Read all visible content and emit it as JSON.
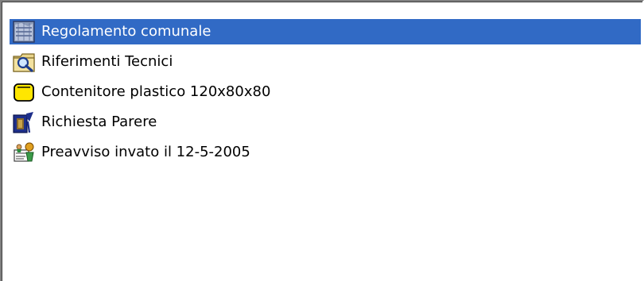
{
  "list": {
    "items": [
      {
        "label": "Regolamento comunale",
        "icon": "regulation-document-icon",
        "selected": true
      },
      {
        "label": "Riferimenti Tecnici",
        "icon": "technical-references-icon",
        "selected": false
      },
      {
        "label": "Contenitore plastico 120x80x80",
        "icon": "container-icon",
        "selected": false
      },
      {
        "label": "Richiesta Parere",
        "icon": "request-opinion-icon",
        "selected": false
      },
      {
        "label": "Preavviso invato il 12-5-2005",
        "icon": "notice-icon",
        "selected": false
      }
    ]
  },
  "colors": {
    "selection": "#316ac5",
    "selection_text": "#ffffff",
    "text": "#000000",
    "background": "#ffffff"
  }
}
